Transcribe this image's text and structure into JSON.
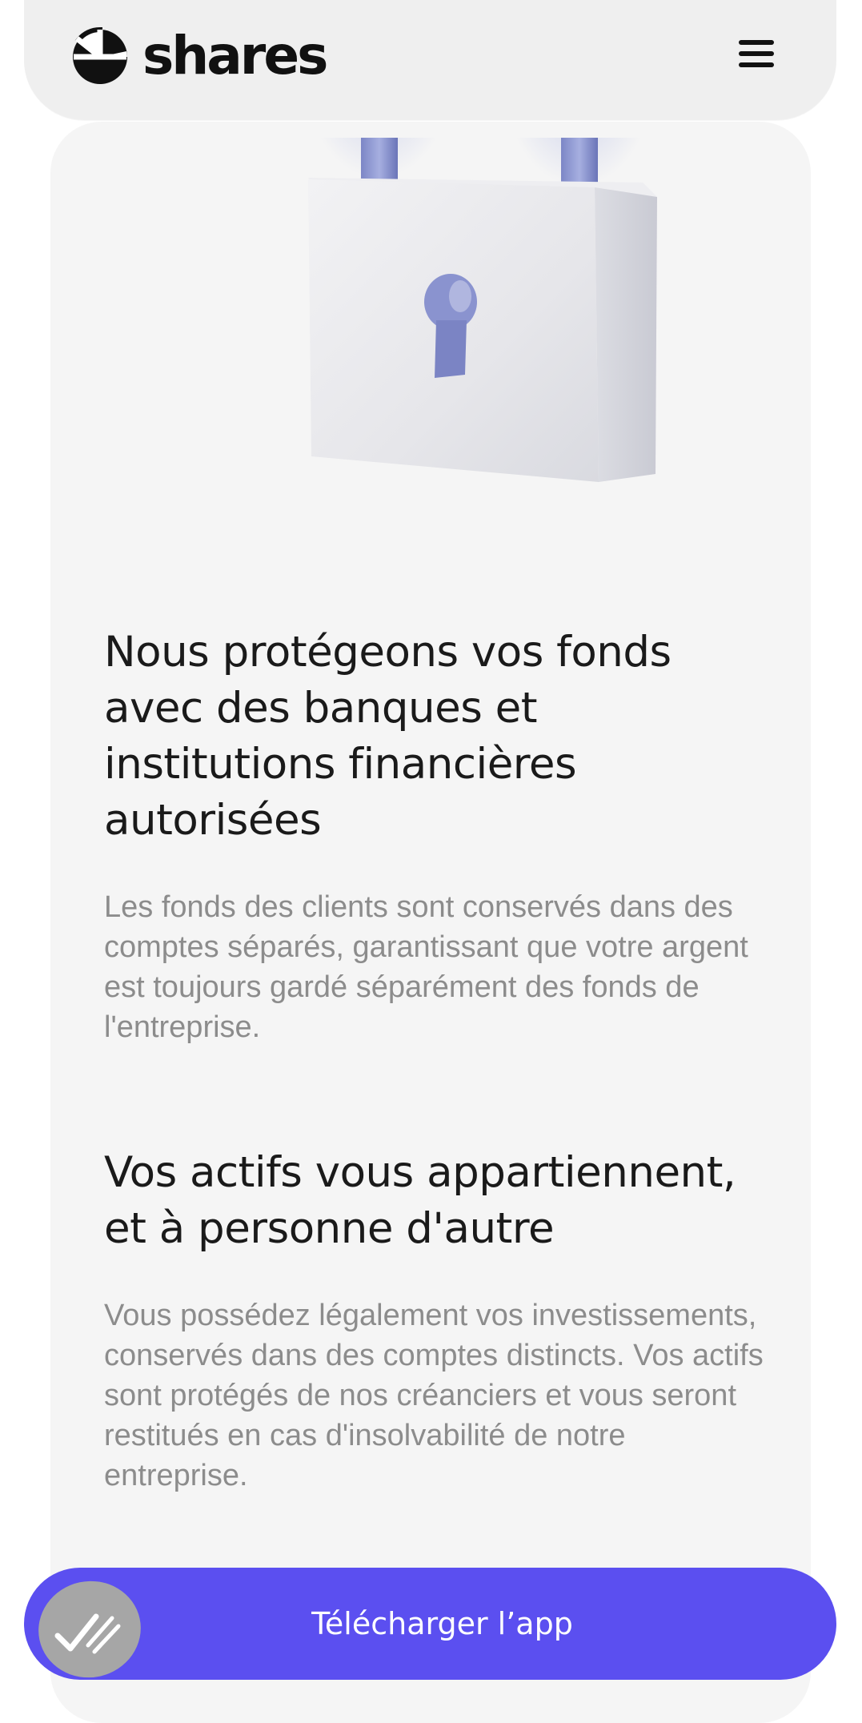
{
  "header": {
    "logo_text": "shares",
    "logo_icon": "shares-logo-icon",
    "menu_icon": "hamburger-menu-icon"
  },
  "hero": {
    "image_icon": "padlock-illustration"
  },
  "sections": [
    {
      "title": "Nous protégeons vos fonds avec des banques et institutions financières autorisées",
      "body": "Les fonds des clients sont conservés dans des comptes séparés, garantissant que votre argent est toujours gardé séparément des fonds de l'entreprise."
    },
    {
      "title": "Vos actifs vous appartiennent, et à personne d'autre",
      "body": "Vous possédez légalement vos investissements, conservés dans des comptes distincts. Vos actifs sont protégés de nos créanciers et vous seront restitués en cas d'insolvabilité de notre entreprise."
    }
  ],
  "cta": {
    "label": "Télécharger l’app",
    "badge_icon": "double-check-icon"
  },
  "colors": {
    "accent": "#5b4ff0",
    "card_bg": "#f5f5f5",
    "header_bg": "#efefef",
    "title_text": "#1a1a1a",
    "body_text": "#8c8c8c"
  }
}
